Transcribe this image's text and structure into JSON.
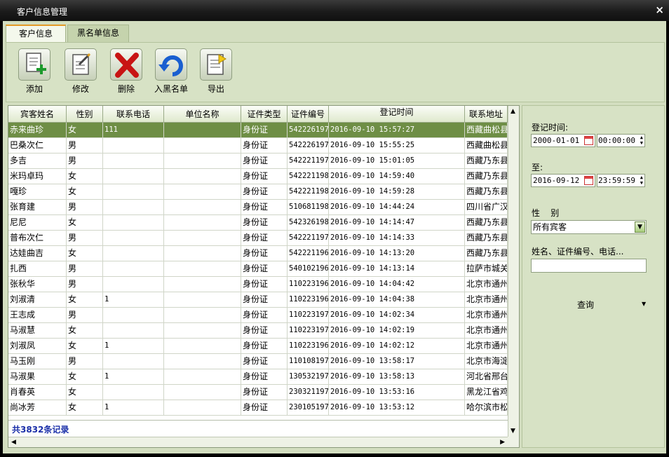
{
  "window": {
    "title": "客户信息管理",
    "close_glyph": "×"
  },
  "tabs": [
    {
      "label": "客户信息",
      "active": true
    },
    {
      "label": "黑名单信息",
      "active": false
    }
  ],
  "toolbar": {
    "add": {
      "label": "添加",
      "icon": "add-document-icon"
    },
    "edit": {
      "label": "修改",
      "icon": "edit-document-icon"
    },
    "delete": {
      "label": "删除",
      "icon": "delete-x-icon"
    },
    "blacklist": {
      "label": "入黑名单",
      "icon": "undo-arrow-icon"
    },
    "export": {
      "label": "导出",
      "icon": "export-document-icon"
    }
  },
  "table": {
    "columns": [
      "宾客姓名",
      "性别",
      "联系电话",
      "单位名称",
      "证件类型",
      "证件编号",
      "登记时间",
      "联系地址"
    ],
    "rows": [
      [
        "赤来曲珍",
        "女",
        "111",
        "",
        "身份证",
        "542226197",
        "2016-09-10 15:57:27",
        "西藏曲松县"
      ],
      [
        "巴桑次仁",
        "男",
        "",
        "",
        "身份证",
        "542226197",
        "2016-09-10 15:55:25",
        "西藏曲松县"
      ],
      [
        "多吉",
        "男",
        "",
        "",
        "身份证",
        "542221197",
        "2016-09-10 15:01:05",
        "西藏乃东县"
      ],
      [
        "米玛卓玛",
        "女",
        "",
        "",
        "身份证",
        "542221198",
        "2016-09-10 14:59:40",
        "西藏乃东县"
      ],
      [
        "嘎珍",
        "女",
        "",
        "",
        "身份证",
        "542221198",
        "2016-09-10 14:59:28",
        "西藏乃东县"
      ],
      [
        "张育建",
        "男",
        "",
        "",
        "身份证",
        "510681198",
        "2016-09-10 14:44:24",
        "四川省广汉"
      ],
      [
        "尼尼",
        "女",
        "",
        "",
        "身份证",
        "542326198",
        "2016-09-10 14:14:47",
        "西藏乃东县"
      ],
      [
        "普布次仁",
        "男",
        "",
        "",
        "身份证",
        "542221197",
        "2016-09-10 14:14:33",
        "西藏乃东县"
      ],
      [
        "达娃曲吉",
        "女",
        "",
        "",
        "身份证",
        "542221196",
        "2016-09-10 14:13:20",
        "西藏乃东县"
      ],
      [
        "扎西",
        "男",
        "",
        "",
        "身份证",
        "540102196",
        "2016-09-10 14:13:14",
        "拉萨市城关"
      ],
      [
        "张秋华",
        "男",
        "",
        "",
        "身份证",
        "110223196",
        "2016-09-10 14:04:42",
        "北京市通州"
      ],
      [
        "刘淑清",
        "女",
        "1",
        "",
        "身份证",
        "110223196",
        "2016-09-10 14:04:38",
        "北京市通州"
      ],
      [
        "王志成",
        "男",
        "",
        "",
        "身份证",
        "110223197",
        "2016-09-10 14:02:34",
        "北京市通州"
      ],
      [
        "马淑慧",
        "女",
        "",
        "",
        "身份证",
        "110223197",
        "2016-09-10 14:02:19",
        "北京市通州"
      ],
      [
        "刘淑凤",
        "女",
        "1",
        "",
        "身份证",
        "110223196",
        "2016-09-10 14:02:12",
        "北京市通州"
      ],
      [
        "马玉刚",
        "男",
        "",
        "",
        "身份证",
        "110108197",
        "2016-09-10 13:58:17",
        "北京市海淀"
      ],
      [
        "马淑果",
        "女",
        "1",
        "",
        "身份证",
        "130532197",
        "2016-09-10 13:58:13",
        "河北省邢台"
      ],
      [
        "肖春英",
        "女",
        "",
        "",
        "身份证",
        "230321197",
        "2016-09-10 13:53:16",
        "黑龙江省鸡"
      ],
      [
        "尚冰芳",
        "女",
        "1",
        "",
        "身份证",
        "230105197",
        "2016-09-10 13:53:12",
        "哈尔滨市松"
      ]
    ],
    "footer_text": "共3832条记录"
  },
  "filter": {
    "start_label": "登记时间:",
    "start_date": "2000-01-01",
    "start_time": "00:00:00",
    "end_label": "至:",
    "end_date": "2016-09-12",
    "end_time": "23:59:59",
    "gender_label": "性    别",
    "gender_value": "所有宾客",
    "search_label": "姓名、证件编号、电话...",
    "search_value": "",
    "query_label": "查询"
  },
  "colors": {
    "selected_row": "#6e8e45",
    "panel_bg": "#d7e2c5",
    "footer_text": "#1a2fa8"
  }
}
